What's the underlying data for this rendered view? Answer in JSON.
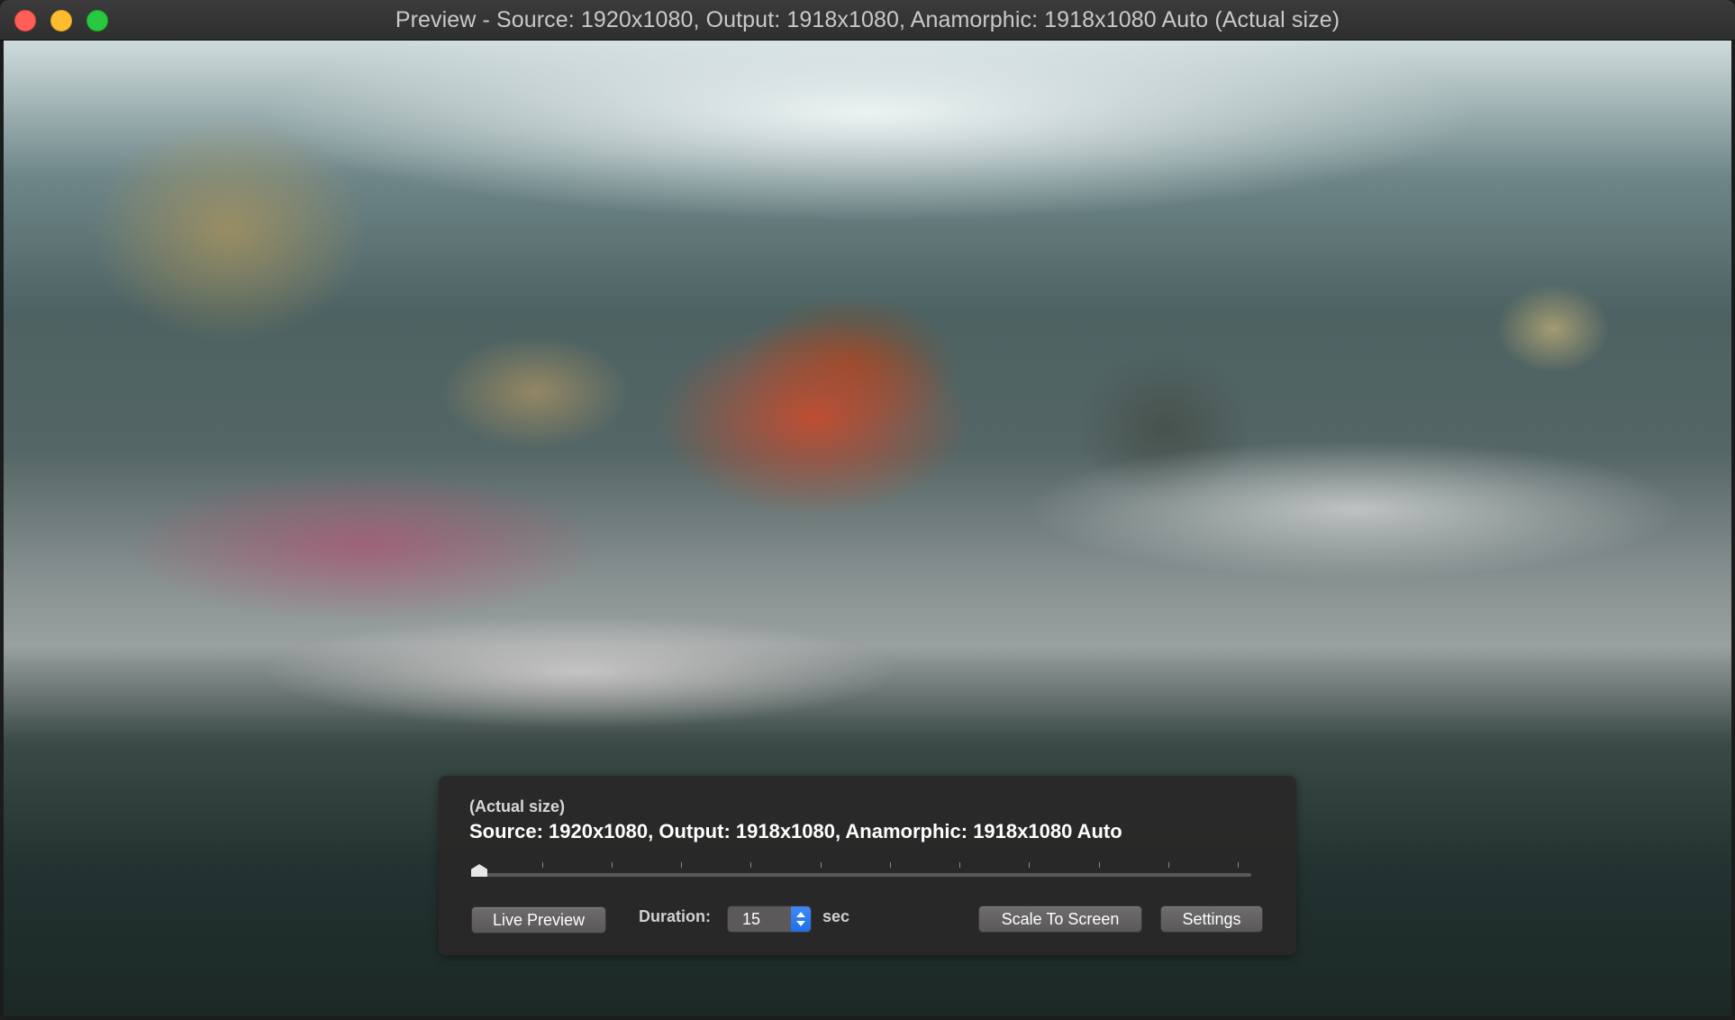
{
  "window": {
    "title": "Preview - Source: 1920x1080, Output: 1918x1080, Anamorphic: 1918x1080 Auto (Actual size)"
  },
  "hud": {
    "scale_label": "(Actual size)",
    "info": "Source: 1920x1080, Output: 1918x1080, Anamorphic: 1918x1080 Auto",
    "slider_position": 0,
    "live_preview_label": "Live Preview",
    "duration_label": "Duration:",
    "duration_value": "15",
    "duration_unit": "sec",
    "scale_to_screen_label": "Scale To Screen",
    "settings_label": "Settings"
  },
  "colors": {
    "close": "#ff5f57",
    "minimize": "#febc2e",
    "zoom": "#28c840",
    "stepper_accent": "#2f7ff0"
  },
  "icons": {
    "close": "close-icon",
    "minimize": "minimize-icon",
    "zoom": "zoom-icon",
    "stepper": "stepper-arrows-icon"
  }
}
